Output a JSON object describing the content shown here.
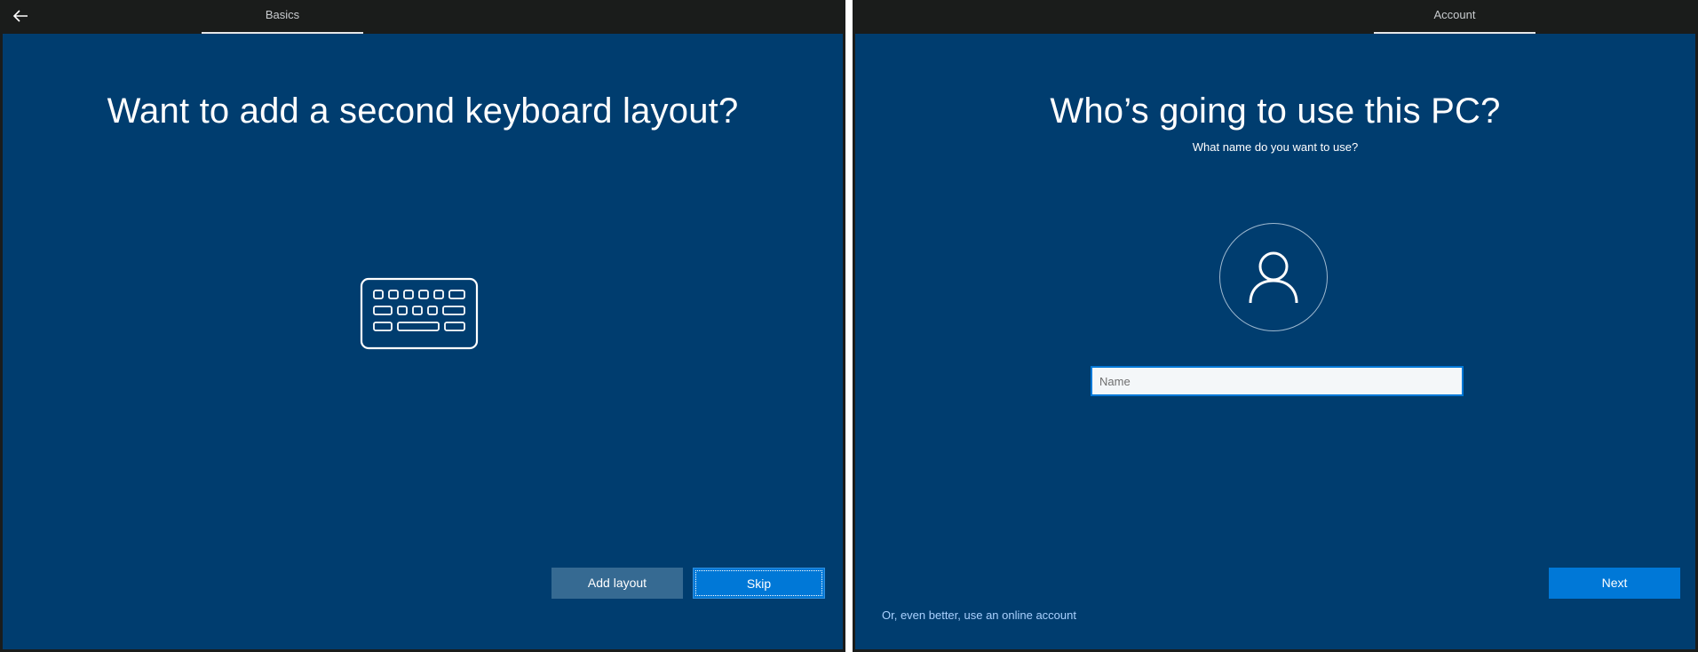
{
  "left_screen": {
    "tab_label": "Basics",
    "title": "Want to add a second keyboard layout?",
    "icon": "keyboard-icon",
    "buttons": {
      "add_layout": "Add layout",
      "skip": "Skip"
    }
  },
  "right_screen": {
    "tab_label": "Account",
    "title": "Who’s going to use this PC?",
    "subtitle": "What name do you want to use?",
    "icon": "user-icon",
    "name_input": {
      "placeholder": "Name",
      "value": ""
    },
    "online_account_link": "Or, even better, use an online account",
    "next_label": "Next"
  },
  "colors": {
    "background": "#003d6f",
    "topbar": "#1a1c1b",
    "accent": "#0078d7",
    "secondary_button": "#366a92",
    "link": "#a9d1ff"
  }
}
